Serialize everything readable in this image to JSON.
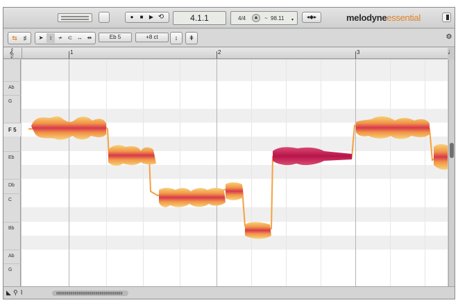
{
  "transport": {
    "position": "4.1.1",
    "time_signature": "4/4",
    "tempo_separator": "~",
    "tempo": "98.11",
    "record_icon": "record-icon",
    "stop_icon": "stop-icon",
    "play_icon": "play-icon",
    "loop_icon": "loop-icon"
  },
  "app": {
    "brand": "melodyne",
    "edition": "essential"
  },
  "toolbar": {
    "pitch_field": "Eb 5",
    "cents_field": "+8 ct"
  },
  "ruler": {
    "bars": [
      "1",
      "2",
      "3"
    ]
  },
  "pitch_ruler": {
    "rows": [
      "Ab",
      "G",
      "F 5",
      "Eb",
      "Db",
      "C",
      "Bb",
      "Ab",
      "G"
    ]
  },
  "colors": {
    "blob_outer": "#f7d27a",
    "blob_mid": "#f08a3c",
    "blob_core": "#c8265e",
    "selected_blob": "#c81e55",
    "pitch_line": "#f5a040",
    "dark_lane": "#ededed",
    "accent": "#e0822a"
  }
}
